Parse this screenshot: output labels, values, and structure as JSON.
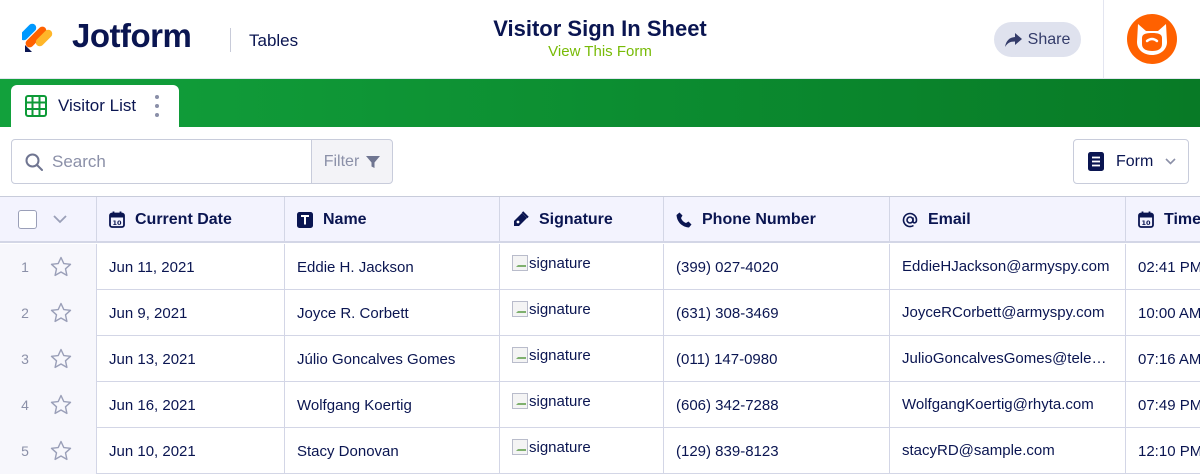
{
  "app": {
    "brand": "Jotform",
    "section": "Tables",
    "form_title": "Visitor Sign In Sheet",
    "form_link": "View This Form",
    "share_label": "Share",
    "colors": {
      "brand_navy": "#0a1551",
      "link_green": "#78bb07",
      "tabbar_green": "#0b8a2f",
      "avatar_orange": "#ff6100"
    }
  },
  "tabs": [
    {
      "label": "Visitor List",
      "icon": "table-grid-icon"
    }
  ],
  "toolbar": {
    "search_placeholder": "Search",
    "filter_label": "Filter",
    "view_label": "Form"
  },
  "table": {
    "columns": [
      {
        "label": "Current Date",
        "icon": "calendar-icon"
      },
      {
        "label": "Name",
        "icon": "text-icon"
      },
      {
        "label": "Signature",
        "icon": "pen-icon"
      },
      {
        "label": "Phone Number",
        "icon": "phone-icon"
      },
      {
        "label": "Email",
        "icon": "at-icon"
      },
      {
        "label": "Time",
        "icon": "calendar-icon"
      }
    ],
    "rows": [
      {
        "num": "1",
        "date": "Jun 11, 2021",
        "name": "Eddie H. Jackson",
        "signature": "signature",
        "phone": "(399) 027-4020",
        "email": "EddieHJackson@armyspy.com",
        "time": "02:41 PM"
      },
      {
        "num": "2",
        "date": "Jun 9, 2021",
        "name": "Joyce R. Corbett",
        "signature": "signature",
        "phone": "(631) 308-3469",
        "email": "JoyceRCorbett@armyspy.com",
        "time": "10:00 AM"
      },
      {
        "num": "3",
        "date": "Jun 13, 2021",
        "name": "Júlio Goncalves Gomes",
        "signature": "signature",
        "phone": "(011) 147-0980",
        "email": "JulioGoncalvesGomes@teleworm.us",
        "time": "07:16 AM"
      },
      {
        "num": "4",
        "date": "Jun 16, 2021",
        "name": "Wolfgang Koertig",
        "signature": "signature",
        "phone": "(606) 342-7288",
        "email": "WolfgangKoertig@rhyta.com",
        "time": "07:49 PM"
      },
      {
        "num": "5",
        "date": "Jun 10, 2021",
        "name": "Stacy Donovan",
        "signature": "signature",
        "phone": "(129) 839-8123",
        "email": "stacyRD@sample.com",
        "time": "12:10 PM"
      }
    ]
  }
}
